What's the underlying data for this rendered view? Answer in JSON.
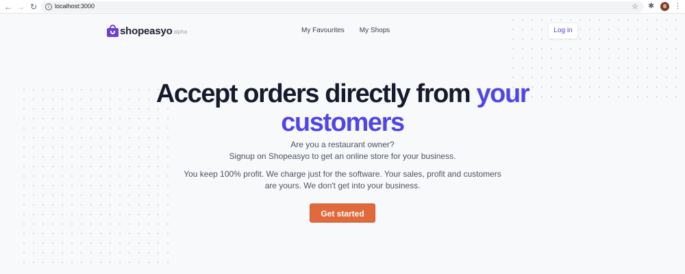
{
  "browser": {
    "url": "localhost:3000",
    "back_icon": "←",
    "forward_icon": "→",
    "reload_icon": "↻",
    "info_icon": "i",
    "star_icon": "☆",
    "extensions_icon": "✱",
    "menu_icon": "⋮"
  },
  "header": {
    "logo_text": "shopeasyo",
    "logo_tag": "alpha",
    "nav": [
      {
        "label": "My Favourites"
      },
      {
        "label": "My Shops"
      }
    ],
    "login_label": "Log in"
  },
  "hero": {
    "title_line1": "Accept orders directly from ",
    "title_accent1": "your",
    "title_accent2": "customers",
    "question": "Are you a restaurant owner?",
    "signup_line": "Signup on Shopeasyo to get an online store for your business.",
    "profit_line1": "You keep 100% profit. We charge just for the software. Your sales, profit and customers",
    "profit_line2": "are yours. We don't get into your business.",
    "cta_label": "Get started"
  },
  "colors": {
    "brand": "#6c3fd6",
    "accent": "#4f46e5",
    "cta": "#e06a3b",
    "background": "#f8f9fb"
  }
}
